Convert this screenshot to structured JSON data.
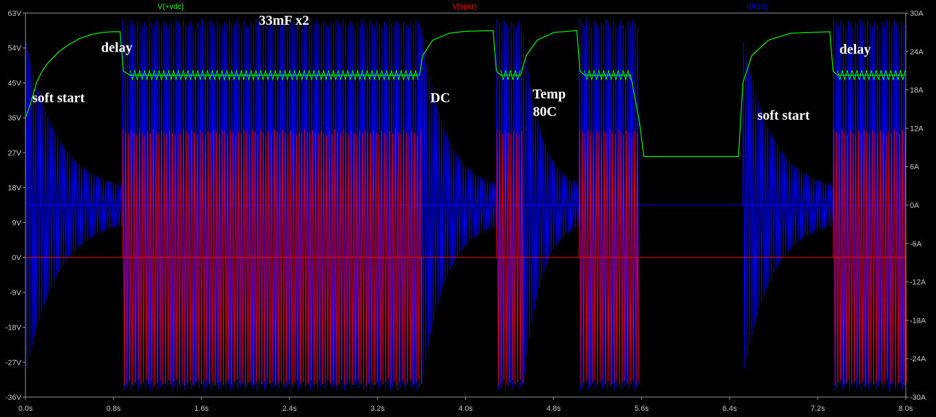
{
  "chart_data": {
    "type": "line",
    "x_unit": "s",
    "xlim": [
      0.0,
      8.0
    ],
    "x_ticks": [
      "0.0s",
      "0.8s",
      "1.6s",
      "2.4s",
      "3.2s",
      "4.0s",
      "4.8s",
      "5.6s",
      "6.4s",
      "7.2s",
      "8.0s"
    ],
    "y_left_lim": [
      -36,
      63
    ],
    "y_left_ticks": [
      "63V",
      "54V",
      "45V",
      "36V",
      "27V",
      "18V",
      "9V",
      "0V",
      "-9V",
      "-18V",
      "-27V",
      "-36V"
    ],
    "y_right_lim": [
      -30,
      30
    ],
    "y_right_ticks": [
      "30A",
      "24A",
      "18A",
      "12A",
      "6A",
      "0A",
      "-6A",
      "-12A",
      "-18A",
      "-24A",
      "-30A"
    ],
    "grid": false,
    "series": [
      {
        "name": "V(+vdc)",
        "color": "#00ff00",
        "axis": "left",
        "points": [
          [
            0.0,
            36
          ],
          [
            0.05,
            40
          ],
          [
            0.1,
            45
          ],
          [
            0.15,
            48
          ],
          [
            0.2,
            50
          ],
          [
            0.3,
            53
          ],
          [
            0.4,
            55
          ],
          [
            0.5,
            56.5
          ],
          [
            0.6,
            57.5
          ],
          [
            0.7,
            58
          ],
          [
            0.8,
            58.2
          ],
          [
            0.86,
            58.2
          ],
          [
            0.89,
            48
          ],
          [
            0.95,
            47
          ],
          [
            3.58,
            47
          ],
          [
            3.61,
            52
          ],
          [
            3.7,
            56
          ],
          [
            3.85,
            57.8
          ],
          [
            4.0,
            58.3
          ],
          [
            4.25,
            58.5
          ],
          [
            4.28,
            48
          ],
          [
            4.32,
            47
          ],
          [
            4.5,
            47
          ],
          [
            4.55,
            52
          ],
          [
            4.65,
            56
          ],
          [
            4.8,
            58
          ],
          [
            5.01,
            58.5
          ],
          [
            5.04,
            48
          ],
          [
            5.08,
            47
          ],
          [
            5.5,
            47
          ],
          [
            5.58,
            35
          ],
          [
            5.62,
            26
          ],
          [
            6.48,
            26
          ],
          [
            6.52,
            45
          ],
          [
            6.6,
            52
          ],
          [
            6.75,
            56
          ],
          [
            6.95,
            57.8
          ],
          [
            7.31,
            58.2
          ],
          [
            7.34,
            48
          ],
          [
            7.38,
            47
          ],
          [
            8.0,
            47
          ]
        ],
        "ripple_segments": [
          [
            0.95,
            3.58,
            2.5
          ],
          [
            4.32,
            4.5,
            2.5
          ],
          [
            5.08,
            5.5,
            2.5
          ],
          [
            7.38,
            8.0,
            2.5
          ]
        ]
      },
      {
        "name": "V(spkr)",
        "color": "#ff0000",
        "axis": "left",
        "baseline": 0,
        "burst_segments": [
          [
            0.88,
            3.6,
            33,
            -33
          ],
          [
            4.28,
            4.52,
            33,
            -33
          ],
          [
            5.03,
            5.56,
            33,
            -33
          ],
          [
            7.34,
            8.0,
            33,
            -33
          ]
        ],
        "burst_period": 0.025
      },
      {
        "name": "I(R21)",
        "color": "#0000ff",
        "axis": "right",
        "baseline": 0,
        "burst_segments": [
          [
            0.88,
            3.6,
            29,
            -29
          ],
          [
            4.28,
            4.52,
            29,
            -29
          ],
          [
            5.03,
            5.56,
            29,
            -29
          ],
          [
            7.34,
            8.0,
            29,
            -29
          ]
        ],
        "decay_segments": [
          [
            0.0,
            0.88,
            26,
            -26
          ],
          [
            3.6,
            4.28,
            27,
            -27
          ],
          [
            4.52,
            5.03,
            27,
            -27
          ],
          [
            6.52,
            7.34,
            26,
            -26
          ]
        ],
        "burst_period": 0.022
      }
    ]
  },
  "annotations": [
    {
      "text": "33mF x2",
      "x": 2.35,
      "y": 60
    },
    {
      "text": "delay",
      "x": 0.83,
      "y": 53
    },
    {
      "text": "soft start",
      "x": 0.3,
      "y": 40
    },
    {
      "text": "DC",
      "x": 3.77,
      "y": 40
    },
    {
      "text": "Temp",
      "x": 4.76,
      "y": 41
    },
    {
      "text": "80C",
      "x": 4.72,
      "y": 36.5
    },
    {
      "text": "soft start",
      "x": 6.89,
      "y": 35.5
    },
    {
      "text": "delay",
      "x": 7.54,
      "y": 52.5
    }
  ]
}
